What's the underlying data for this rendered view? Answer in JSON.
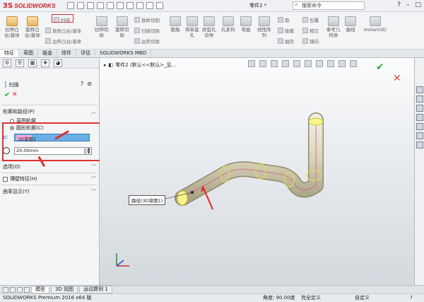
{
  "app": {
    "logo_mark": "3S",
    "logo_text": "SOLIDWORKS",
    "doc_title": "零件2 *",
    "search_placeholder": "搜索命令",
    "window_controls": [
      "?",
      "–",
      "□"
    ]
  },
  "ribbon": {
    "large_buttons": [
      {
        "label": "拉伸凸\n台/基体",
        "color": "orange"
      },
      {
        "label": "旋转凸\n台/基体",
        "color": "orange"
      },
      {
        "label": "拉伸切\n除",
        "color": "gray"
      },
      {
        "label": "旋转切\n除",
        "color": "gray"
      },
      {
        "label": "圆角",
        "color": "gray"
      },
      {
        "label": "简单直\n孔",
        "color": "gray"
      },
      {
        "label": "异型孔\n向导",
        "color": "gray"
      },
      {
        "label": "孔系列",
        "color": "gray"
      },
      {
        "label": "弯曲",
        "color": "gray"
      },
      {
        "label": "线性阵\n列",
        "color": "gray"
      },
      {
        "label": "参考几\n何体",
        "color": "gray"
      },
      {
        "label": "曲线",
        "color": "gray"
      },
      {
        "label": "Instant3D",
        "color": "gray"
      }
    ],
    "small_buttons": [
      "扫描",
      "放样凸台/基体",
      "边界凸台/基体",
      "放样切割",
      "扫描切除",
      "边界切除",
      "筋",
      "拔模",
      "抽壳",
      "包覆",
      "相交",
      "镜向"
    ]
  },
  "tabs": [
    "特征",
    "草图",
    "钣金",
    "焊件",
    "评估",
    "SOLIDWORKS MBD"
  ],
  "property_manager": {
    "tab_icons": [
      "⚙",
      "☰",
      "▦",
      "✥",
      "◕"
    ],
    "title": "扫描",
    "help_icons": [
      "?",
      "⊘"
    ],
    "section_profile": "轮廓和路径(P)",
    "radio_sketch_profile": "草图轮廓",
    "radio_circular_profile": "圆形轮廓(C)",
    "path_field": "3D草图1",
    "diameter_field": "20.00mm",
    "section_options": "选项(O)",
    "thin_feature": "薄壁特征(H)",
    "curvature_display": "曲率显示(Y)"
  },
  "viewport": {
    "breadcrumb": "零件2  (默认<<默认>_显...",
    "callout": "路径(3D草图1)"
  },
  "bottom_tabs": [
    "模型",
    "3D 视图",
    "运动算例 1"
  ],
  "status": {
    "app_version": "SOLIDWORKS Premium 2016 x64 版",
    "angle": "角度: 90.00度",
    "fully_defined": "完全定义",
    "custom": "自定义",
    "help": "?"
  }
}
